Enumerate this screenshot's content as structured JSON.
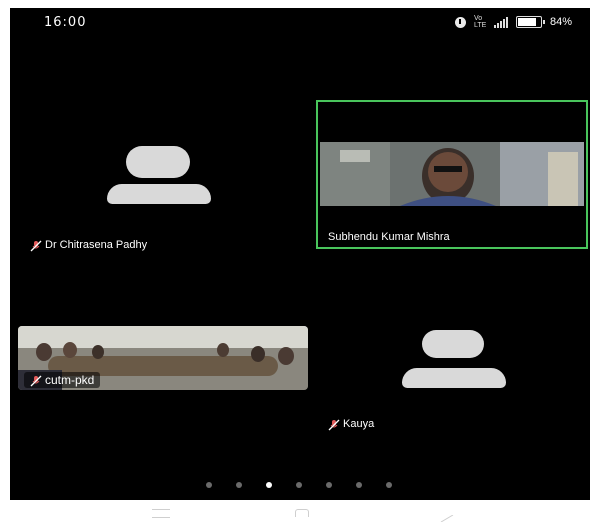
{
  "status_bar": {
    "time": "16:00",
    "battery_percent": "84%",
    "battery_level": 0.84,
    "icons": [
      "alarm-icon",
      "volte-icon",
      "signal-icon",
      "battery-icon"
    ]
  },
  "participants": [
    {
      "name": "Dr Chitrasena Padhy",
      "muted": true,
      "video": false
    },
    {
      "name": "Subhendu Kumar Mishra",
      "muted": false,
      "video": true,
      "active_speaker": true
    },
    {
      "name": "cutm-pkd",
      "muted": true,
      "video": true
    },
    {
      "name": "Kauya",
      "muted": true,
      "video": false
    }
  ],
  "pager": {
    "count": 7,
    "active_index": 2
  },
  "colors": {
    "background": "#000000",
    "active_speaker_border": "#49c55c",
    "avatar": "#d9d9d9",
    "muted_icon": "#e25b5b"
  },
  "nav_bar": {
    "icons": [
      "menu-icon",
      "home-icon",
      "back-icon"
    ]
  }
}
